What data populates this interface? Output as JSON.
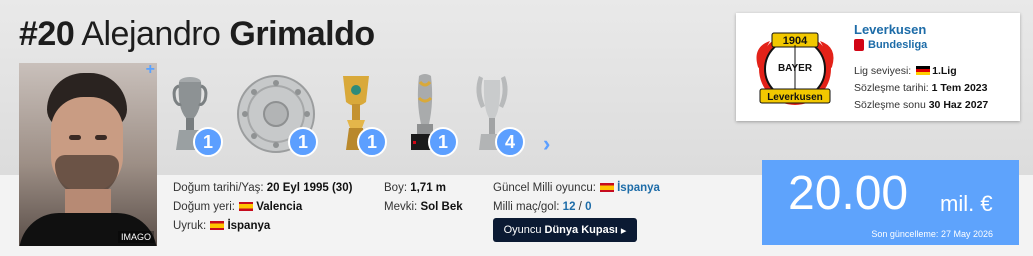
{
  "player": {
    "number": "#20",
    "first_name": "Alejandro",
    "last_name": "Grimaldo",
    "photo_credit": "IMAGO"
  },
  "trophies": [
    {
      "icon": "euro-trophy-icon",
      "count": "1"
    },
    {
      "icon": "bundesliga-plate-icon",
      "count": "1"
    },
    {
      "icon": "dfb-pokal-icon",
      "count": "1"
    },
    {
      "icon": "supercup-trophy-icon",
      "count": "1"
    },
    {
      "icon": "silver-cup-icon",
      "count": "4"
    }
  ],
  "club": {
    "name": "Leverkusen",
    "league": "Bundesliga",
    "league_level_label": "Lig seviyesi:",
    "league_level": "1.Lig",
    "joined_label": "Sözleşme tarihi:",
    "joined": "1 Tem 2023",
    "contract_label": "Sözleşme sonu",
    "contract_end": "30 Haz 2027",
    "logo_year": "1904",
    "logo_text": "BAYER",
    "logo_name": "Leverkusen"
  },
  "info": {
    "birth_label": "Doğum tarihi/Yaş:",
    "birth": "20 Eyl 1995 (30)",
    "birthplace_label": "Doğum yeri:",
    "birthplace": "Valencia",
    "citizenship_label": "Uyruk:",
    "citizenship": "İspanya",
    "height_label": "Boy:",
    "height": "1,71 m",
    "position_label": "Mevki:",
    "position": "Sol Bek",
    "national_label": "Güncel Milli oyuncu:",
    "national": "İspanya",
    "caps_label": "Milli maç/gol:",
    "caps": "12",
    "caps_sep": "/",
    "goals": "0"
  },
  "button": {
    "prefix": "Oyuncu",
    "bold": "Dünya Kupası",
    "arrow": "▸"
  },
  "market_value": {
    "amount": "20.00",
    "unit": "mil. €",
    "updated_label": "Son güncelleme:",
    "updated": "27 May 2026"
  },
  "colors": {
    "accent": "#5ea3fc",
    "link": "#1d6ca8",
    "button_bg": "#0b1a33"
  }
}
